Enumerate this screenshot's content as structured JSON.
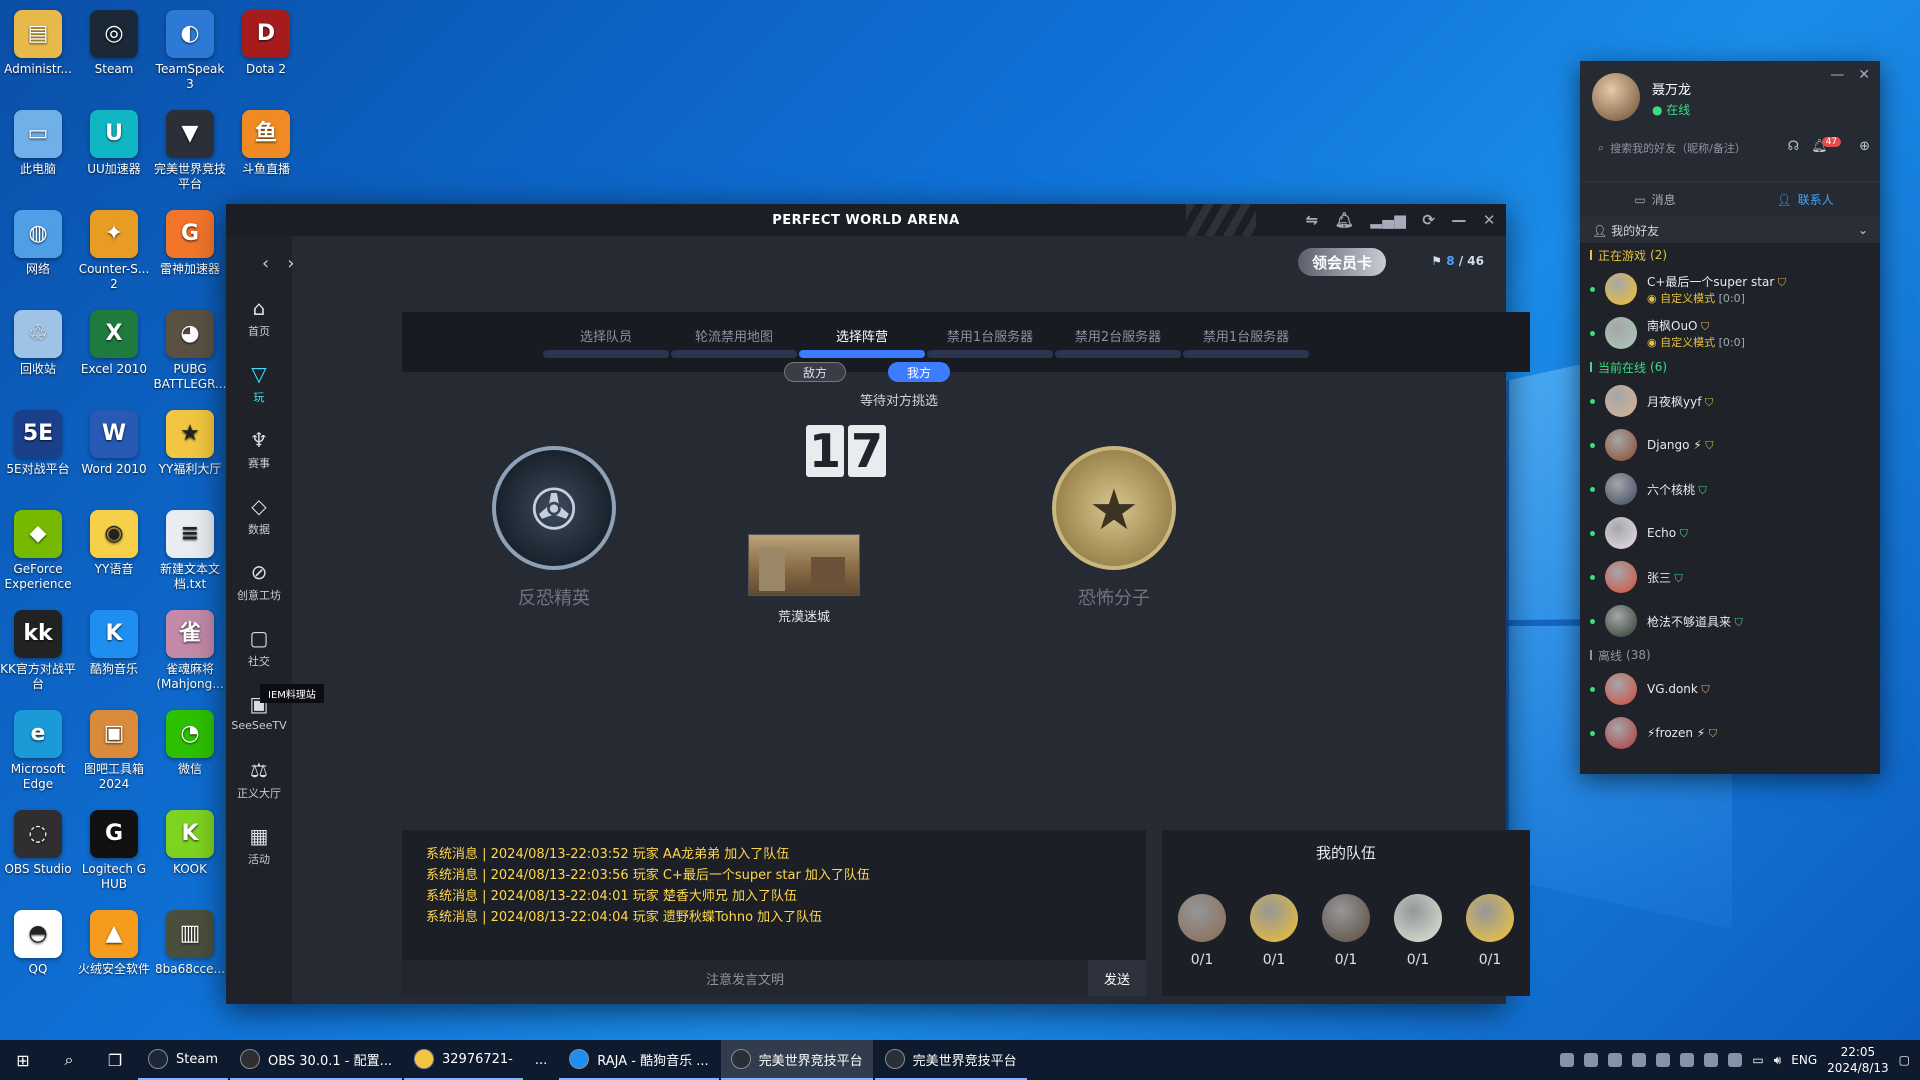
{
  "desktop": {
    "icons": [
      {
        "label": "Administr...",
        "color": "#e7b84a",
        "glyph": "▤",
        "col": 0,
        "row": 0
      },
      {
        "label": "Steam",
        "color": "#1b2838",
        "glyph": "◎",
        "col": 1,
        "row": 0
      },
      {
        "label": "TeamSpeak 3",
        "color": "#2d7ad6",
        "glyph": "◐",
        "col": 2,
        "row": 0
      },
      {
        "label": "Dota 2",
        "color": "#a61b1b",
        "glyph": "D",
        "col": 3,
        "row": 0
      },
      {
        "label": "此电脑",
        "color": "#6fb0e8",
        "glyph": "▭",
        "col": 0,
        "row": 1
      },
      {
        "label": "UU加速器",
        "color": "#10b6c4",
        "glyph": "U",
        "col": 1,
        "row": 1
      },
      {
        "label": "完美世界竞技平台",
        "color": "#2b2f38",
        "glyph": "▼",
        "col": 2,
        "row": 1
      },
      {
        "label": "斗鱼直播",
        "color": "#f08a24",
        "glyph": "鱼",
        "col": 3,
        "row": 1
      },
      {
        "label": "网络",
        "color": "#4f9ee6",
        "glyph": "◍",
        "col": 0,
        "row": 2
      },
      {
        "label": "Counter-S... 2",
        "color": "#e89c23",
        "glyph": "✦",
        "col": 1,
        "row": 2
      },
      {
        "label": "雷神加速器",
        "color": "#f2752b",
        "glyph": "G",
        "col": 2,
        "row": 2
      },
      {
        "label": "回收站",
        "color": "#9fc3e6",
        "glyph": "♲",
        "col": 0,
        "row": 3
      },
      {
        "label": "Excel 2010",
        "color": "#1f7a3e",
        "glyph": "X",
        "col": 1,
        "row": 3
      },
      {
        "label": "PUBG BATTLEGR...",
        "color": "#5a5144",
        "glyph": "◕",
        "col": 2,
        "row": 3
      },
      {
        "label": "5E对战平台",
        "color": "#1c3f8c",
        "glyph": "5E",
        "col": 0,
        "row": 4
      },
      {
        "label": "Word 2010",
        "color": "#2859b5",
        "glyph": "W",
        "col": 1,
        "row": 4
      },
      {
        "label": "YY福利大厅",
        "color": "#f2c640",
        "glyph": "★",
        "col": 2,
        "row": 4
      },
      {
        "label": "GeForce Experience",
        "color": "#76b900",
        "glyph": "◆",
        "col": 0,
        "row": 5
      },
      {
        "label": "YY语音",
        "color": "#f7d04a",
        "glyph": "◉",
        "col": 1,
        "row": 5
      },
      {
        "label": "新建文本文档.txt",
        "color": "#e9edf2",
        "glyph": "≡",
        "col": 2,
        "row": 5
      },
      {
        "label": "KK官方对战平台",
        "color": "#222222",
        "glyph": "kk",
        "col": 0,
        "row": 6
      },
      {
        "label": "酷狗音乐",
        "color": "#1f8ef1",
        "glyph": "K",
        "col": 1,
        "row": 6
      },
      {
        "label": "雀魂麻将(Mahjong...",
        "color": "#c28aa8",
        "glyph": "雀",
        "col": 2,
        "row": 6
      },
      {
        "label": "Microsoft Edge",
        "color": "#1a9bd7",
        "glyph": "e",
        "col": 0,
        "row": 7
      },
      {
        "label": "图吧工具箱2024",
        "color": "#d98a3a",
        "glyph": "▣",
        "col": 1,
        "row": 7
      },
      {
        "label": "微信",
        "color": "#2dc100",
        "glyph": "◔",
        "col": 2,
        "row": 7
      },
      {
        "label": "OBS Studio",
        "color": "#302e31",
        "glyph": "◌",
        "col": 0,
        "row": 8
      },
      {
        "label": "Logitech G HUB",
        "color": "#111111",
        "glyph": "G",
        "col": 1,
        "row": 8
      },
      {
        "label": "KOOK",
        "color": "#7ed321",
        "glyph": "K",
        "col": 2,
        "row": 8
      },
      {
        "label": "QQ",
        "color": "#ffffff",
        "glyph": "◓",
        "col": 0,
        "row": 9
      },
      {
        "label": "火绒安全软件",
        "color": "#f59b1d",
        "glyph": "▲",
        "col": 1,
        "row": 9
      },
      {
        "label": "8ba68cce...",
        "color": "#4a4f3d",
        "glyph": "▥",
        "col": 2,
        "row": 9
      }
    ]
  },
  "taskbar": {
    "apps": [
      {
        "label": "Steam",
        "color": "#1b2838",
        "active": false
      },
      {
        "label": "OBS 30.0.1 - 配置...",
        "color": "#302e31",
        "active": false
      },
      {
        "label": "32976721-",
        "color": "#f2c640",
        "active": false
      },
      {
        "label": "...",
        "color": "",
        "active": false
      },
      {
        "label": "RAJA - 酷狗音乐 ...",
        "color": "#1f8ef1",
        "active": false
      },
      {
        "label": "完美世界竞技平台",
        "color": "#2b2f38",
        "active": true
      },
      {
        "label": "完美世界竞技平台",
        "color": "#2b2f38",
        "active": false
      }
    ],
    "lang": "ENG",
    "time": "22:05",
    "date": "2024/8/13"
  },
  "app": {
    "title": "PERFECT WORLD ARENA",
    "vip_label": "领会员卡",
    "online": {
      "current": "8",
      "total": "/ 46"
    },
    "sidebar": [
      {
        "label": "首页",
        "icon": "home-icon",
        "glyph": "⌂",
        "active": false
      },
      {
        "label": "玩",
        "icon": "play-icon",
        "glyph": "▽",
        "active": true
      },
      {
        "label": "赛事",
        "icon": "trophy-icon",
        "glyph": "♆",
        "active": false
      },
      {
        "label": "数据",
        "icon": "data-icon",
        "glyph": "◇",
        "active": false
      },
      {
        "label": "创意工坊",
        "icon": "workshop-icon",
        "glyph": "⊘",
        "active": false
      },
      {
        "label": "社交",
        "icon": "social-icon",
        "glyph": "▢",
        "active": false
      },
      {
        "label": "SeeSeeTV",
        "icon": "tv-icon",
        "glyph": "▣",
        "active": false
      },
      {
        "label": "正义大厅",
        "icon": "justice-icon",
        "glyph": "⚖",
        "active": false
      },
      {
        "label": "活动",
        "icon": "calendar-icon",
        "glyph": "▦",
        "active": false
      }
    ],
    "iem_tag": "IEM料理站",
    "steps": [
      {
        "label": "选择队员",
        "active": false
      },
      {
        "label": "轮流禁用地图",
        "active": false
      },
      {
        "label": "选择阵营",
        "active": true
      },
      {
        "label": "禁用1台服务器",
        "active": false
      },
      {
        "label": "禁用2台服务器",
        "active": false
      },
      {
        "label": "禁用1台服务器",
        "active": false
      }
    ],
    "side_tabs": {
      "enemy": "敌方",
      "ours": "我方"
    },
    "waiting_text": "等待对方挑选",
    "timer": [
      "1",
      "7"
    ],
    "map_name": "荒漠迷城",
    "teams": {
      "ct": "反恐精英",
      "t": "恐怖分子"
    },
    "chat": {
      "lines": [
        "系统消息 | 2024/08/13-22:03:52 玩家 AA龙弟弟 加入了队伍",
        "系统消息 | 2024/08/13-22:03:56 玩家 C+最后一个super star 加入了队伍",
        "系统消息 | 2024/08/13-22:04:01 玩家 楚香大师兄 加入了队伍",
        "系统消息 | 2024/08/13-22:04:04 玩家 遗野秋蝶Tohno 加入了队伍"
      ],
      "placeholder": "注意发言文明",
      "send": "发送"
    },
    "my_team": {
      "title": "我的队伍",
      "slots": [
        {
          "value": "0/1",
          "color": "#8a6a52"
        },
        {
          "value": "0/1",
          "color": "#f2c12e"
        },
        {
          "value": "0/1",
          "color": "#5b4a3c"
        },
        {
          "value": "0/1",
          "color": "#dfe8d6"
        },
        {
          "value": "0/1",
          "color": "#f5c73a"
        }
      ]
    }
  },
  "friends": {
    "name": "聂万龙",
    "status": "● 在线",
    "search_placeholder": "搜索我的好友（昵称/备注）",
    "badge": "47",
    "tabs": {
      "messages": "消息",
      "contacts": "联系人"
    },
    "group": "我的好友",
    "in_game": {
      "title": "正在游戏",
      "count": "(2)",
      "items": [
        {
          "name": "C+最后一个super star",
          "mode": "◉ 自定义模式",
          "count": "[0:0]",
          "color": "#f2c12e"
        },
        {
          "name": "南枫OuO",
          "mode": "◉ 自定义模式",
          "count": "[0:0]",
          "color": "#a9c9b6"
        }
      ]
    },
    "online": {
      "title": "当前在线",
      "count": "(6)",
      "items": [
        {
          "name": "月夜枫yyf",
          "color": "#d7b38f"
        },
        {
          "name": "Django ⚡",
          "color": "#8a4a2a"
        },
        {
          "name": "六个核桃",
          "color": "#3b4660"
        },
        {
          "name": "Echo",
          "color": "#e8e0e6"
        },
        {
          "name": "张三",
          "color": "#d64d3a"
        },
        {
          "name": "枪法不够道具来",
          "color": "#2c3b2c"
        }
      ]
    },
    "offline": {
      "title": "离线",
      "count": "(38)",
      "items": [
        {
          "name": "VG.donk",
          "color": "#d04a3a"
        },
        {
          "name": "⚡frozen ⚡",
          "color": "#b23a3a"
        }
      ]
    }
  }
}
